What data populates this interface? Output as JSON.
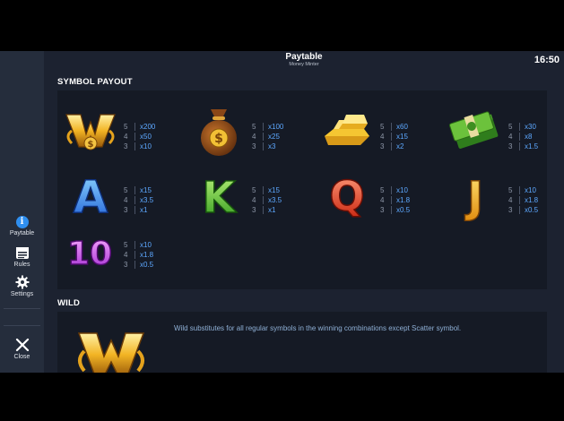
{
  "header": {
    "title": "Paytable",
    "subtitle": "Money Minter",
    "clock": "16:50"
  },
  "sidebar": {
    "paytable_label": "Paytable",
    "rules_label": "Rules",
    "settings_label": "Settings",
    "close_label": "Close"
  },
  "sections": {
    "symbol_payout_title": "SYMBOL PAYOUT",
    "wild_title": "WILD",
    "wild_text": "Wild substitutes for all regular symbols in the winning combinations except Scatter symbol."
  },
  "symbols": [
    {
      "name": "wild-w",
      "rows": [
        {
          "n": "5",
          "v": "x200"
        },
        {
          "n": "4",
          "v": "x50"
        },
        {
          "n": "3",
          "v": "x10"
        }
      ]
    },
    {
      "name": "money-bag",
      "rows": [
        {
          "n": "5",
          "v": "x100"
        },
        {
          "n": "4",
          "v": "x25"
        },
        {
          "n": "3",
          "v": "x3"
        }
      ]
    },
    {
      "name": "gold-bars",
      "rows": [
        {
          "n": "5",
          "v": "x60"
        },
        {
          "n": "4",
          "v": "x15"
        },
        {
          "n": "3",
          "v": "x2"
        }
      ]
    },
    {
      "name": "cash-stack",
      "rows": [
        {
          "n": "5",
          "v": "x30"
        },
        {
          "n": "4",
          "v": "x8"
        },
        {
          "n": "3",
          "v": "x1.5"
        }
      ]
    },
    {
      "name": "letter-a",
      "glyph": "A",
      "rows": [
        {
          "n": "5",
          "v": "x15"
        },
        {
          "n": "4",
          "v": "x3.5"
        },
        {
          "n": "3",
          "v": "x1"
        }
      ]
    },
    {
      "name": "letter-k",
      "glyph": "K",
      "rows": [
        {
          "n": "5",
          "v": "x15"
        },
        {
          "n": "4",
          "v": "x3.5"
        },
        {
          "n": "3",
          "v": "x1"
        }
      ]
    },
    {
      "name": "letter-q",
      "glyph": "Q",
      "rows": [
        {
          "n": "5",
          "v": "x10"
        },
        {
          "n": "4",
          "v": "x1.8"
        },
        {
          "n": "3",
          "v": "x0.5"
        }
      ]
    },
    {
      "name": "letter-j",
      "glyph": "J",
      "rows": [
        {
          "n": "5",
          "v": "x10"
        },
        {
          "n": "4",
          "v": "x1.8"
        },
        {
          "n": "3",
          "v": "x0.5"
        }
      ]
    },
    {
      "name": "number-10",
      "glyph": "10",
      "rows": [
        {
          "n": "5",
          "v": "x10"
        },
        {
          "n": "4",
          "v": "x1.8"
        },
        {
          "n": "3",
          "v": "x0.5"
        }
      ]
    }
  ],
  "colors": {
    "accent": "#5da8ff",
    "panel": "#151a25",
    "background": "#1c2230",
    "sidebar": "#252d3c"
  }
}
